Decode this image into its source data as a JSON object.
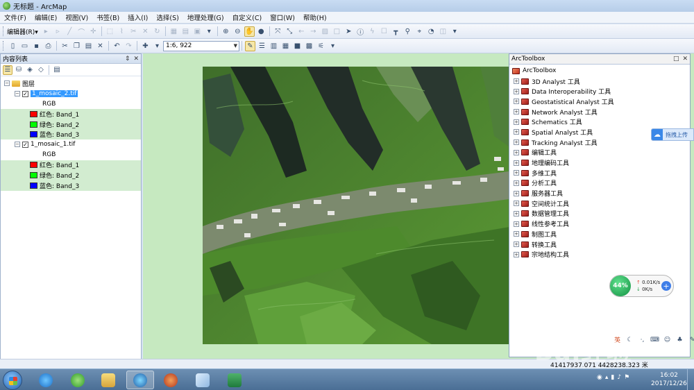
{
  "window": {
    "title": "无标题 - ArcMap"
  },
  "menu": [
    "文件(F)",
    "编辑(E)",
    "视图(V)",
    "书签(B)",
    "插入(I)",
    "选择(S)",
    "地理处理(G)",
    "自定义(C)",
    "窗口(W)",
    "帮助(H)"
  ],
  "toolbar": {
    "editor_label": "编辑器(R)▾",
    "scale": "1:6, 922"
  },
  "toc": {
    "title": "内容列表",
    "root": "图层",
    "layers": [
      {
        "name": "1_mosaic_2.tif",
        "render": "RGB",
        "bands": [
          {
            "label": "红色:  Band_1",
            "color": "#ff0000"
          },
          {
            "label": "绿色: Band_2",
            "color": "#00ff00"
          },
          {
            "label": "蓝色:  Band_3",
            "color": "#0000ff"
          }
        ]
      },
      {
        "name": "1_mosaic_1.tif",
        "render": "RGB",
        "bands": [
          {
            "label": "红色:  Band_1",
            "color": "#ff0000"
          },
          {
            "label": "绿色: Band_2",
            "color": "#00ff00"
          },
          {
            "label": "蓝色:  Band_3",
            "color": "#0000ff"
          }
        ]
      }
    ]
  },
  "toolbox": {
    "title": "ArcToolbox",
    "root": "ArcToolbox",
    "items": [
      "3D Analyst 工具",
      "Data Interoperability 工具",
      "Geostatistical Analyst 工具",
      "Network Analyst 工具",
      "Schematics 工具",
      "Spatial Analyst 工具",
      "Tracking Analyst 工具",
      "编辑工具",
      "地理编码工具",
      "多维工具",
      "分析工具",
      "服务器工具",
      "空间统计工具",
      "数据管理工具",
      "线性参考工具",
      "制图工具",
      "转换工具",
      "宗地结构工具"
    ]
  },
  "cloud": {
    "label": "拖拽上传"
  },
  "speed": {
    "percent": "44%",
    "up": "0.01K/s",
    "down": "0K/s"
  },
  "status": {
    "coords": "41417937.071  4428238.323 米"
  },
  "watermark": {
    "logo": "Bai经验",
    "url": "jingyan.baidu.com"
  },
  "clock": {
    "time": "16:02",
    "date": "2017/12/26"
  },
  "colors": {
    "map_bg": "#c6e9c0",
    "band_row": "#d2ecd0",
    "selection": "#3399ff"
  }
}
